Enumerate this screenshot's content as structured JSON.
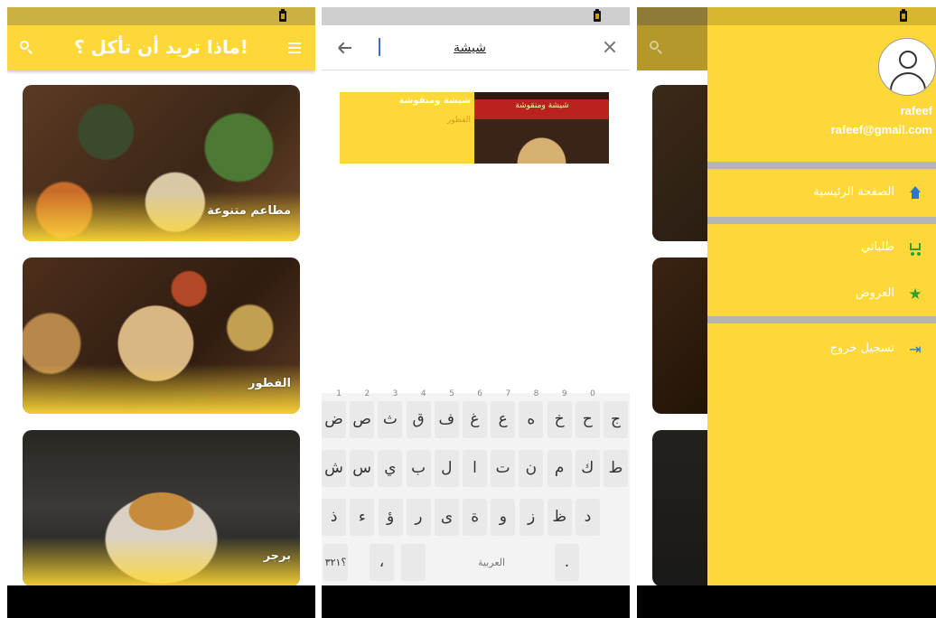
{
  "screen1": {
    "title": "ماذا تريد أن تأكل ؟!",
    "categories": [
      {
        "label": "مطاعم متنوعة"
      },
      {
        "label": "الفطور"
      },
      {
        "label": "برجر"
      }
    ]
  },
  "screen2": {
    "search": {
      "value": "شيشة"
    },
    "result": {
      "name": "شيشة ومنقوشة",
      "category": "الفطور",
      "sign_text": "شيشة ومنقوشة"
    },
    "keyboard": {
      "row1": [
        {
          "k": "ج",
          "n": ""
        },
        {
          "k": "ح",
          "n": "0"
        },
        {
          "k": "خ",
          "n": "9"
        },
        {
          "k": "ه",
          "n": "8"
        },
        {
          "k": "ع",
          "n": "7"
        },
        {
          "k": "غ",
          "n": "6"
        },
        {
          "k": "ف",
          "n": "5"
        },
        {
          "k": "ق",
          "n": "4"
        },
        {
          "k": "ث",
          "n": "3"
        },
        {
          "k": "ص",
          "n": "2"
        },
        {
          "k": "ض",
          "n": "1"
        }
      ],
      "row2": [
        "ط",
        "ك",
        "م",
        "ن",
        "ت",
        "ا",
        "ل",
        "ب",
        "ي",
        "س",
        "ش"
      ],
      "row3": [
        "د",
        "ظ",
        "ز",
        "و",
        "ة",
        "ى",
        "ر",
        "ؤ",
        "ء",
        "ذ"
      ],
      "row4": {
        "symbols": "؟٣٢١",
        "comma": "،",
        "space": "العربية",
        "period": "."
      }
    }
  },
  "screen3": {
    "user": {
      "name": "rafeef",
      "email": "rafeef@gmail.com"
    },
    "menu": [
      {
        "label": "الصفحة الرئيسية",
        "icon": "home-icon"
      },
      {
        "label": "طلباتي",
        "icon": "cart-icon"
      },
      {
        "label": "العروض",
        "icon": "star-icon"
      },
      {
        "label": "تسجيل خروج",
        "icon": "logout-icon"
      }
    ]
  },
  "colors": {
    "primary": "#fed738",
    "home_icon": "#2f76c7",
    "cart_icon": "#2fa02f",
    "divider": "#b5b5b5"
  }
}
